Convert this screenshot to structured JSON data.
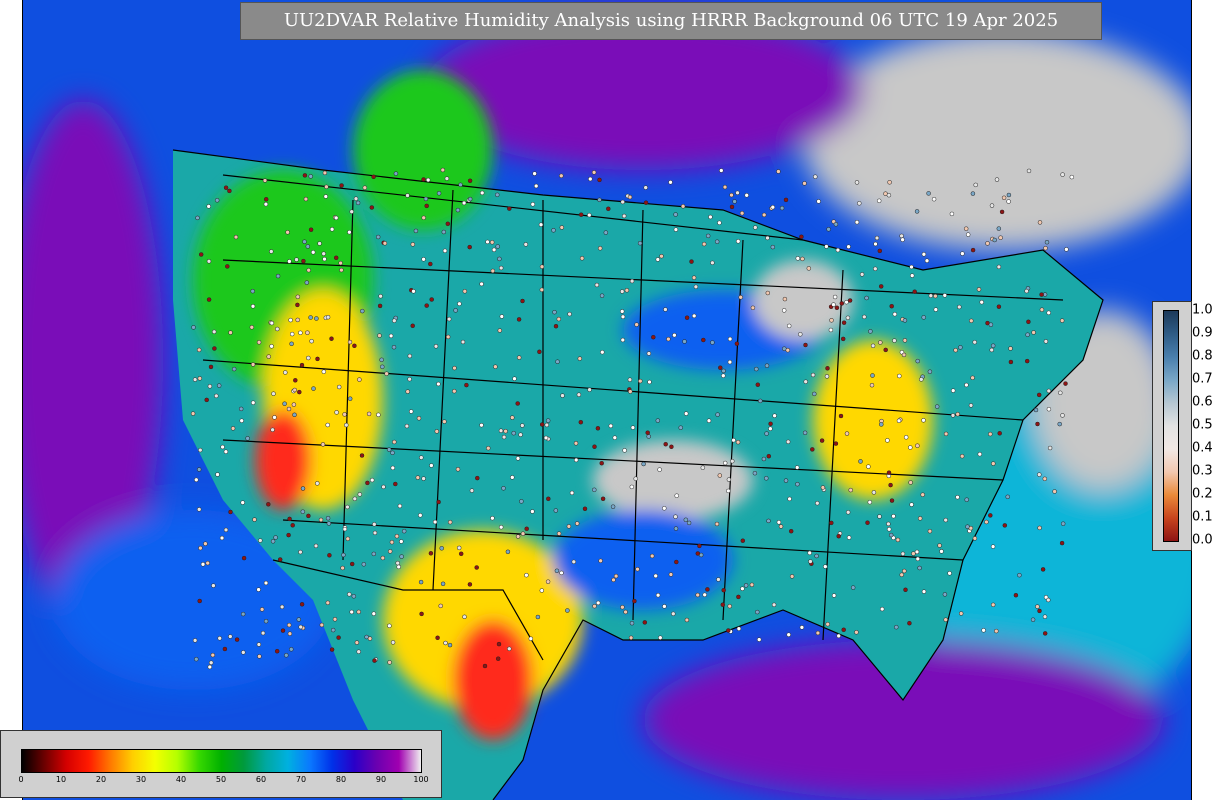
{
  "title": "UU2DVAR Relative Humidity Analysis using HRRR Background 06 UTC 19 Apr 2025",
  "obs_colorbar": {
    "labels": [
      "1.0",
      "0.9",
      "0.8",
      "0.7",
      "0.6",
      "0.5",
      "0.4",
      "0.3",
      "0.2",
      "0.1",
      "0.0"
    ],
    "colors": [
      "#1d3a5a",
      "#2f5c86",
      "#4a7fad",
      "#79a7c7",
      "#b6c7d2",
      "#e3e3e3",
      "#f1e8e4",
      "#f2c8b0",
      "#ea8a3a",
      "#c8441e",
      "#8e1414"
    ]
  },
  "rh_colorbar": {
    "ticks": [
      "0",
      "10",
      "20",
      "30",
      "40",
      "50",
      "60",
      "70",
      "80",
      "90",
      "100"
    ],
    "colors": [
      "#000000",
      "#6b0000",
      "#d40000",
      "#ff1a00",
      "#ff7a00",
      "#ffcf00",
      "#f4ff00",
      "#b4ff00",
      "#36d800",
      "#00b000",
      "#009a3c",
      "#00a8a0",
      "#00b0e0",
      "#0a78ff",
      "#0030e8",
      "#2a00c8",
      "#6a00b0",
      "#a000b0",
      "#f0f0f0"
    ]
  },
  "map": {
    "colors": {
      "ocean": "#0f4fe0",
      "ocean_cyan": "#0bb5d8",
      "purple": "#7a10b8",
      "grey": "#c8c8c8",
      "teal": "#1aa8a8",
      "green": "#1ec81e",
      "yellow": "#ffd800",
      "red": "#ff2a1a",
      "blue": "#1060f0",
      "border": "#000000"
    }
  }
}
